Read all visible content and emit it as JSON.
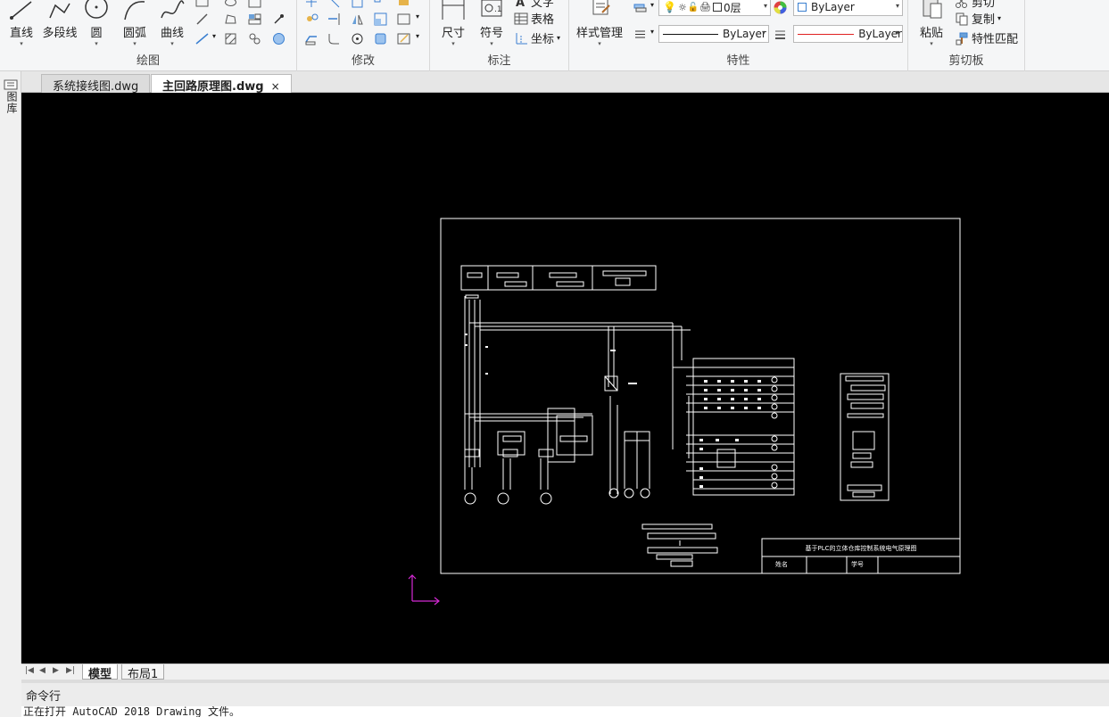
{
  "ribbon": {
    "draw": {
      "title": "绘图",
      "line": "直线",
      "polyline": "多段线",
      "circle": "圆",
      "arc": "圆弧",
      "spline": "曲线"
    },
    "modify": {
      "title": "修改"
    },
    "annotation": {
      "title": "标注",
      "dimension": "尺寸",
      "symbol": "符号",
      "text": "文字",
      "table": "表格",
      "coordinate": "坐标"
    },
    "properties": {
      "title": "特性",
      "style_manager": "样式管理",
      "layer_value": "0层",
      "color_value": "ByLayer",
      "linetype_value": "ByLayer",
      "lineweight_value": "ByLayer"
    },
    "clipboard": {
      "title": "剪切板",
      "paste": "粘贴",
      "cut": "剪切",
      "copy": "复制",
      "match": "特性匹配"
    }
  },
  "left_strip": {
    "label": "图库"
  },
  "doc_tabs": [
    {
      "label": "系统接线图.dwg",
      "active": false
    },
    {
      "label": "主回路原理图.dwg",
      "active": true,
      "close": "×"
    }
  ],
  "drawing": {
    "title_block_title": "基于PLC的立体仓库控制系统电气原理图",
    "name_label": "姓名",
    "id_label": "学号"
  },
  "layout_tabs": [
    {
      "label": "模型",
      "active": true
    },
    {
      "label": "布局1",
      "active": false
    }
  ],
  "command": {
    "header": "命令行",
    "output": "正在打开 AutoCAD 2018 Drawing 文件。"
  },
  "colors": {
    "canvas": "#000000",
    "drawing_lines": "#ffffff",
    "ucs": "#d42ad4",
    "lineweight_red": "#e02020"
  }
}
